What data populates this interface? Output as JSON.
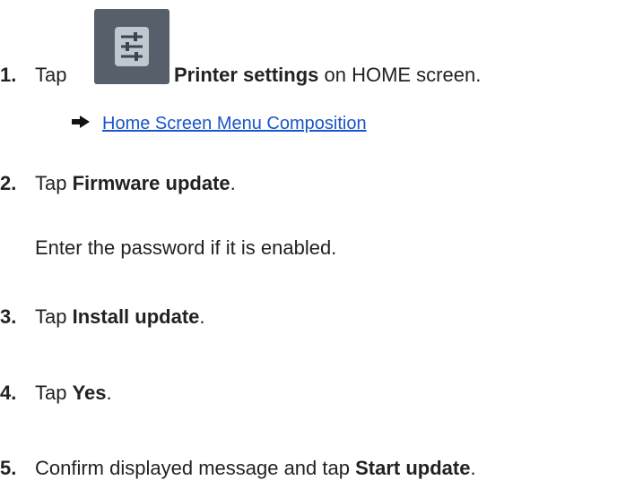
{
  "steps": [
    {
      "number": "1.",
      "prefix": "Tap",
      "bold": "Printer settings",
      "suffix": " on HOME screen.",
      "icon": "printer-settings-icon",
      "link": {
        "text": "Home Screen Menu Composition",
        "icon": "right-arrow-icon"
      }
    },
    {
      "number": "2.",
      "prefix": "Tap ",
      "bold": "Firmware update",
      "suffix": ".",
      "note": "Enter the password if it is enabled."
    },
    {
      "number": "3.",
      "prefix": "Tap ",
      "bold": "Install update",
      "suffix": "."
    },
    {
      "number": "4.",
      "prefix": "Tap ",
      "bold": "Yes",
      "suffix": "."
    },
    {
      "number": "5.",
      "prefix": "Confirm displayed message and tap ",
      "bold": "Start update",
      "suffix": "."
    }
  ],
  "colors": {
    "link": "#1a55c9",
    "icon_bg": "#57606a",
    "icon_fg": "#bfc7cf",
    "text": "#222222"
  }
}
